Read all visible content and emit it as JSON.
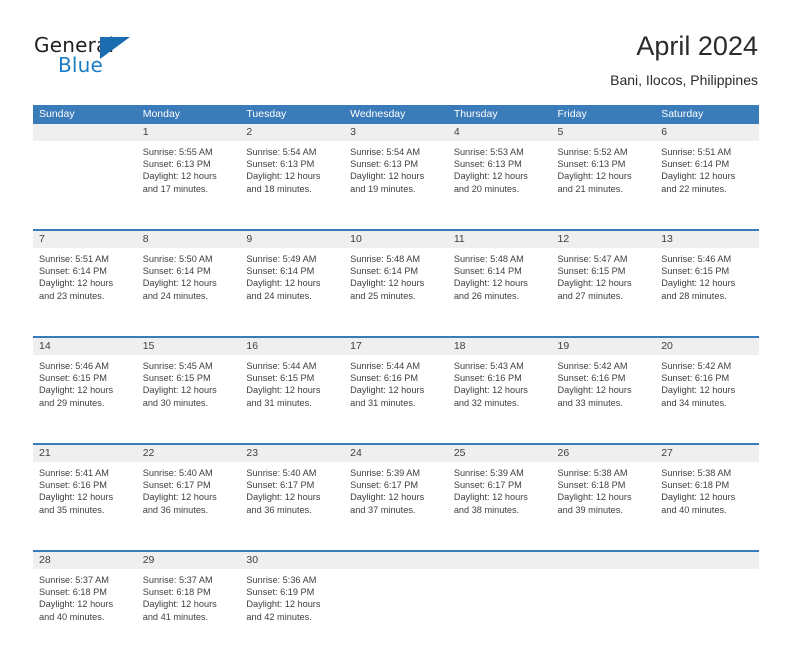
{
  "brand": {
    "name_top": "General",
    "name_bottom": "Blue",
    "accent_color": "#1c7dc4",
    "triangle_color": "#1c6cb0",
    "triangle_icon": "triangle-icon"
  },
  "header": {
    "title": "April 2024",
    "subtitle": "Bani, Ilocos, Philippines"
  },
  "calendar": {
    "header_bg_color": "#3a7cba",
    "daynum_bg_color": "#efefef",
    "weekdays": [
      "Sunday",
      "Monday",
      "Tuesday",
      "Wednesday",
      "Thursday",
      "Friday",
      "Saturday"
    ],
    "weeks": [
      [
        {
          "day": "",
          "sunrise": "",
          "sunset": "",
          "daylight_line1": "",
          "daylight_line2": ""
        },
        {
          "day": "1",
          "sunrise": "Sunrise: 5:55 AM",
          "sunset": "Sunset: 6:13 PM",
          "daylight_line1": "Daylight: 12 hours",
          "daylight_line2": "and 17 minutes."
        },
        {
          "day": "2",
          "sunrise": "Sunrise: 5:54 AM",
          "sunset": "Sunset: 6:13 PM",
          "daylight_line1": "Daylight: 12 hours",
          "daylight_line2": "and 18 minutes."
        },
        {
          "day": "3",
          "sunrise": "Sunrise: 5:54 AM",
          "sunset": "Sunset: 6:13 PM",
          "daylight_line1": "Daylight: 12 hours",
          "daylight_line2": "and 19 minutes."
        },
        {
          "day": "4",
          "sunrise": "Sunrise: 5:53 AM",
          "sunset": "Sunset: 6:13 PM",
          "daylight_line1": "Daylight: 12 hours",
          "daylight_line2": "and 20 minutes."
        },
        {
          "day": "5",
          "sunrise": "Sunrise: 5:52 AM",
          "sunset": "Sunset: 6:13 PM",
          "daylight_line1": "Daylight: 12 hours",
          "daylight_line2": "and 21 minutes."
        },
        {
          "day": "6",
          "sunrise": "Sunrise: 5:51 AM",
          "sunset": "Sunset: 6:14 PM",
          "daylight_line1": "Daylight: 12 hours",
          "daylight_line2": "and 22 minutes."
        }
      ],
      [
        {
          "day": "7",
          "sunrise": "Sunrise: 5:51 AM",
          "sunset": "Sunset: 6:14 PM",
          "daylight_line1": "Daylight: 12 hours",
          "daylight_line2": "and 23 minutes."
        },
        {
          "day": "8",
          "sunrise": "Sunrise: 5:50 AM",
          "sunset": "Sunset: 6:14 PM",
          "daylight_line1": "Daylight: 12 hours",
          "daylight_line2": "and 24 minutes."
        },
        {
          "day": "9",
          "sunrise": "Sunrise: 5:49 AM",
          "sunset": "Sunset: 6:14 PM",
          "daylight_line1": "Daylight: 12 hours",
          "daylight_line2": "and 24 minutes."
        },
        {
          "day": "10",
          "sunrise": "Sunrise: 5:48 AM",
          "sunset": "Sunset: 6:14 PM",
          "daylight_line1": "Daylight: 12 hours",
          "daylight_line2": "and 25 minutes."
        },
        {
          "day": "11",
          "sunrise": "Sunrise: 5:48 AM",
          "sunset": "Sunset: 6:14 PM",
          "daylight_line1": "Daylight: 12 hours",
          "daylight_line2": "and 26 minutes."
        },
        {
          "day": "12",
          "sunrise": "Sunrise: 5:47 AM",
          "sunset": "Sunset: 6:15 PM",
          "daylight_line1": "Daylight: 12 hours",
          "daylight_line2": "and 27 minutes."
        },
        {
          "day": "13",
          "sunrise": "Sunrise: 5:46 AM",
          "sunset": "Sunset: 6:15 PM",
          "daylight_line1": "Daylight: 12 hours",
          "daylight_line2": "and 28 minutes."
        }
      ],
      [
        {
          "day": "14",
          "sunrise": "Sunrise: 5:46 AM",
          "sunset": "Sunset: 6:15 PM",
          "daylight_line1": "Daylight: 12 hours",
          "daylight_line2": "and 29 minutes."
        },
        {
          "day": "15",
          "sunrise": "Sunrise: 5:45 AM",
          "sunset": "Sunset: 6:15 PM",
          "daylight_line1": "Daylight: 12 hours",
          "daylight_line2": "and 30 minutes."
        },
        {
          "day": "16",
          "sunrise": "Sunrise: 5:44 AM",
          "sunset": "Sunset: 6:15 PM",
          "daylight_line1": "Daylight: 12 hours",
          "daylight_line2": "and 31 minutes."
        },
        {
          "day": "17",
          "sunrise": "Sunrise: 5:44 AM",
          "sunset": "Sunset: 6:16 PM",
          "daylight_line1": "Daylight: 12 hours",
          "daylight_line2": "and 31 minutes."
        },
        {
          "day": "18",
          "sunrise": "Sunrise: 5:43 AM",
          "sunset": "Sunset: 6:16 PM",
          "daylight_line1": "Daylight: 12 hours",
          "daylight_line2": "and 32 minutes."
        },
        {
          "day": "19",
          "sunrise": "Sunrise: 5:42 AM",
          "sunset": "Sunset: 6:16 PM",
          "daylight_line1": "Daylight: 12 hours",
          "daylight_line2": "and 33 minutes."
        },
        {
          "day": "20",
          "sunrise": "Sunrise: 5:42 AM",
          "sunset": "Sunset: 6:16 PM",
          "daylight_line1": "Daylight: 12 hours",
          "daylight_line2": "and 34 minutes."
        }
      ],
      [
        {
          "day": "21",
          "sunrise": "Sunrise: 5:41 AM",
          "sunset": "Sunset: 6:16 PM",
          "daylight_line1": "Daylight: 12 hours",
          "daylight_line2": "and 35 minutes."
        },
        {
          "day": "22",
          "sunrise": "Sunrise: 5:40 AM",
          "sunset": "Sunset: 6:17 PM",
          "daylight_line1": "Daylight: 12 hours",
          "daylight_line2": "and 36 minutes."
        },
        {
          "day": "23",
          "sunrise": "Sunrise: 5:40 AM",
          "sunset": "Sunset: 6:17 PM",
          "daylight_line1": "Daylight: 12 hours",
          "daylight_line2": "and 36 minutes."
        },
        {
          "day": "24",
          "sunrise": "Sunrise: 5:39 AM",
          "sunset": "Sunset: 6:17 PM",
          "daylight_line1": "Daylight: 12 hours",
          "daylight_line2": "and 37 minutes."
        },
        {
          "day": "25",
          "sunrise": "Sunrise: 5:39 AM",
          "sunset": "Sunset: 6:17 PM",
          "daylight_line1": "Daylight: 12 hours",
          "daylight_line2": "and 38 minutes."
        },
        {
          "day": "26",
          "sunrise": "Sunrise: 5:38 AM",
          "sunset": "Sunset: 6:18 PM",
          "daylight_line1": "Daylight: 12 hours",
          "daylight_line2": "and 39 minutes."
        },
        {
          "day": "27",
          "sunrise": "Sunrise: 5:38 AM",
          "sunset": "Sunset: 6:18 PM",
          "daylight_line1": "Daylight: 12 hours",
          "daylight_line2": "and 40 minutes."
        }
      ],
      [
        {
          "day": "28",
          "sunrise": "Sunrise: 5:37 AM",
          "sunset": "Sunset: 6:18 PM",
          "daylight_line1": "Daylight: 12 hours",
          "daylight_line2": "and 40 minutes."
        },
        {
          "day": "29",
          "sunrise": "Sunrise: 5:37 AM",
          "sunset": "Sunset: 6:18 PM",
          "daylight_line1": "Daylight: 12 hours",
          "daylight_line2": "and 41 minutes."
        },
        {
          "day": "30",
          "sunrise": "Sunrise: 5:36 AM",
          "sunset": "Sunset: 6:19 PM",
          "daylight_line1": "Daylight: 12 hours",
          "daylight_line2": "and 42 minutes."
        },
        {
          "day": "",
          "sunrise": "",
          "sunset": "",
          "daylight_line1": "",
          "daylight_line2": ""
        },
        {
          "day": "",
          "sunrise": "",
          "sunset": "",
          "daylight_line1": "",
          "daylight_line2": ""
        },
        {
          "day": "",
          "sunrise": "",
          "sunset": "",
          "daylight_line1": "",
          "daylight_line2": ""
        },
        {
          "day": "",
          "sunrise": "",
          "sunset": "",
          "daylight_line1": "",
          "daylight_line2": ""
        }
      ]
    ]
  }
}
